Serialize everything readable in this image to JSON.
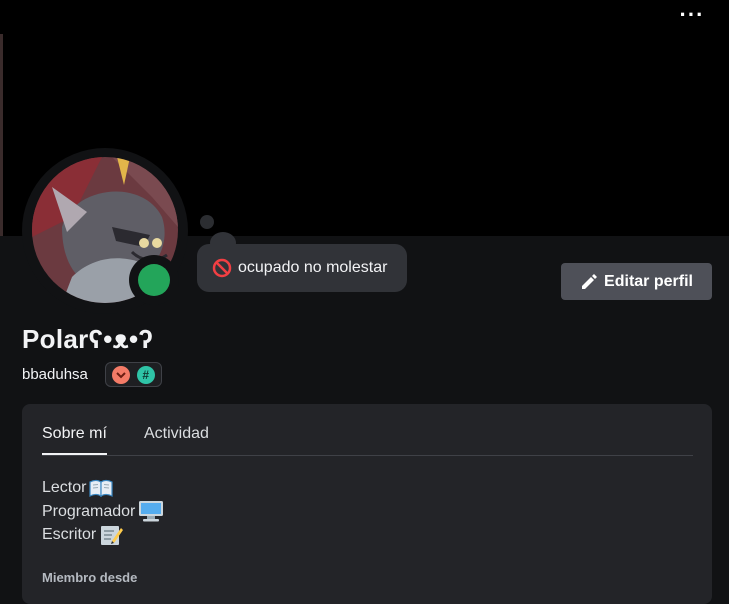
{
  "window": {
    "menu_icon": "more-horizontal-icon"
  },
  "profile": {
    "display_name": "Polarʕ•ᴥ•ʔ",
    "username": "bbaduhsa",
    "status": "dnd",
    "status_color": "#23a55a",
    "custom_status": {
      "icon": "do-not-disturb-icon",
      "text": "ocupado no molestar"
    },
    "badges": [
      {
        "name": "chevron-badge-icon",
        "color": "#f47b67"
      },
      {
        "name": "hash-badge-icon",
        "color": "#2fc4a7"
      }
    ]
  },
  "actions": {
    "edit_profile": "Editar perfil",
    "edit_icon": "pencil-icon"
  },
  "tabs": [
    {
      "label": "Sobre mí",
      "active": true
    },
    {
      "label": "Actividad",
      "active": false
    }
  ],
  "about": {
    "bio_lines": [
      {
        "text": "Lector",
        "emoji": "open-book-icon"
      },
      {
        "text": "Programador",
        "emoji": "computer-icon"
      },
      {
        "text": "Escritor",
        "emoji": "memo-icon"
      }
    ],
    "member_since_label": "Miembro desde"
  },
  "colors": {
    "background": "#111214",
    "card": "#232428",
    "button": "#4e5058",
    "bubble": "#313338",
    "online": "#23a55a",
    "dnd": "#f23f43"
  }
}
